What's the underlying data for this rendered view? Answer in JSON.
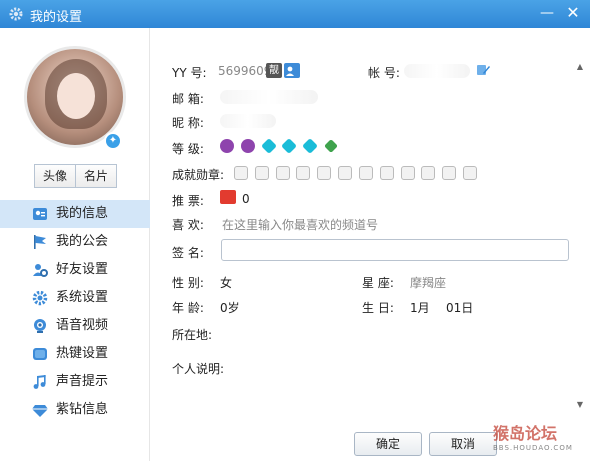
{
  "window": {
    "title": "我的设置",
    "min_icon": "minimize-icon",
    "close_icon": "close-icon"
  },
  "sidebar": {
    "tabs": [
      {
        "label": "头像"
      },
      {
        "label": "名片"
      }
    ],
    "items": [
      {
        "label": "我的信息",
        "icon": "profile-card-icon",
        "active": true
      },
      {
        "label": "我的公会",
        "icon": "flag-icon"
      },
      {
        "label": "好友设置",
        "icon": "friends-gear-icon"
      },
      {
        "label": "系统设置",
        "icon": "gear-icon"
      },
      {
        "label": "语音视频",
        "icon": "voice-video-icon"
      },
      {
        "label": "热键设置",
        "icon": "hotkey-icon"
      },
      {
        "label": "声音提示",
        "icon": "music-note-icon"
      },
      {
        "label": "紫钻信息",
        "icon": "diamond-icon"
      }
    ]
  },
  "info": {
    "yy_label": "YY 号:",
    "yy_value": "5699609",
    "yy_tag": "靓",
    "account_label": "帐 号:",
    "email_label": "邮 箱:",
    "nick_label": "昵 称:",
    "level_label": "等 级:",
    "medal_label": "成就勋章:",
    "vote_label": "推 票:",
    "vote_value": "0",
    "like_label": "喜 欢:",
    "like_placeholder": "在这里输入你最喜欢的频道号",
    "sign_label": "签 名:",
    "gender_label": "性 别:",
    "gender_value": "女",
    "star_label": "星 座:",
    "star_value": "摩羯座",
    "age_label": "年 龄:",
    "age_value": "0岁",
    "birthday_label": "生 日:",
    "birthday_month": "1月",
    "birthday_day": "01日",
    "location_label": "所在地:",
    "bio_label": "个人说明:"
  },
  "buttons": {
    "ok": "确定",
    "cancel": "取消"
  },
  "watermark": {
    "text": "猴岛论坛",
    "sub": "BBS.HOUDAO.COM"
  },
  "colors": {
    "titlebar": "#3b93dc",
    "active_nav": "#d3e6f8",
    "accent": "#2f86d6"
  }
}
